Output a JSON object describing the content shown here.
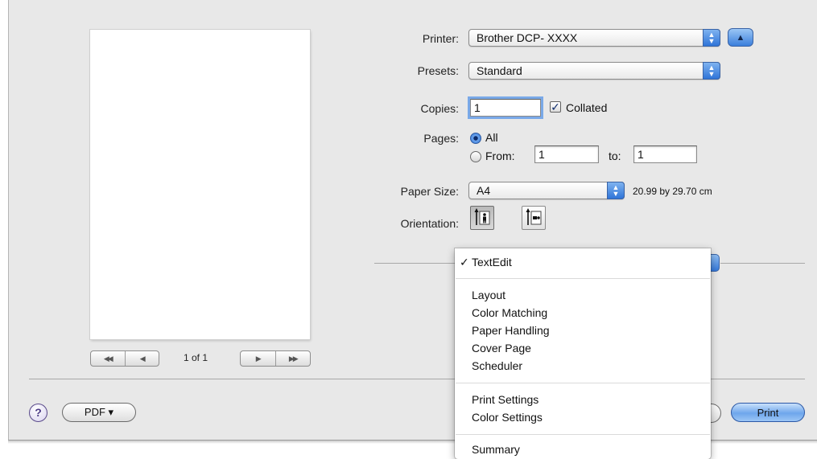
{
  "printer": {
    "label": "Printer:",
    "value": "Brother DCP- XXXX"
  },
  "presets": {
    "label": "Presets:",
    "value": "Standard"
  },
  "copies": {
    "label": "Copies:",
    "value": "1",
    "collated_label": "Collated",
    "collated_checked": true
  },
  "pages": {
    "label": "Pages:",
    "all_label": "All",
    "from_label": "From:",
    "from_value": "1",
    "to_label": "to:",
    "to_value": "1",
    "selected": "All"
  },
  "paper_size": {
    "label": "Paper Size:",
    "value": "A4",
    "dimensions": "20.99 by 29.70 cm"
  },
  "orientation": {
    "label": "Orientation:",
    "options": [
      "portrait",
      "landscape"
    ],
    "selected": "portrait"
  },
  "preview": {
    "page_count": "1 of 1"
  },
  "section_menu": {
    "selected": "TextEdit",
    "groups": [
      [
        "TextEdit"
      ],
      [
        "Layout",
        "Color Matching",
        "Paper Handling",
        "Cover Page",
        "Scheduler"
      ],
      [
        "Print Settings",
        "Color Settings"
      ],
      [
        "Summary"
      ]
    ]
  },
  "buttons": {
    "help": "?",
    "pdf": "PDF ▾",
    "print": "Print"
  },
  "icons": {
    "popup": "up-down-arrows-icon",
    "disclosure": "triangle-up-icon",
    "help": "help-icon",
    "nav_first": "first-page-icon",
    "nav_prev": "previous-page-icon",
    "nav_next": "next-page-icon",
    "nav_last": "last-page-icon"
  },
  "colors": {
    "accent": "#3b7fdc",
    "sheet_background": "#e8e8e8"
  }
}
